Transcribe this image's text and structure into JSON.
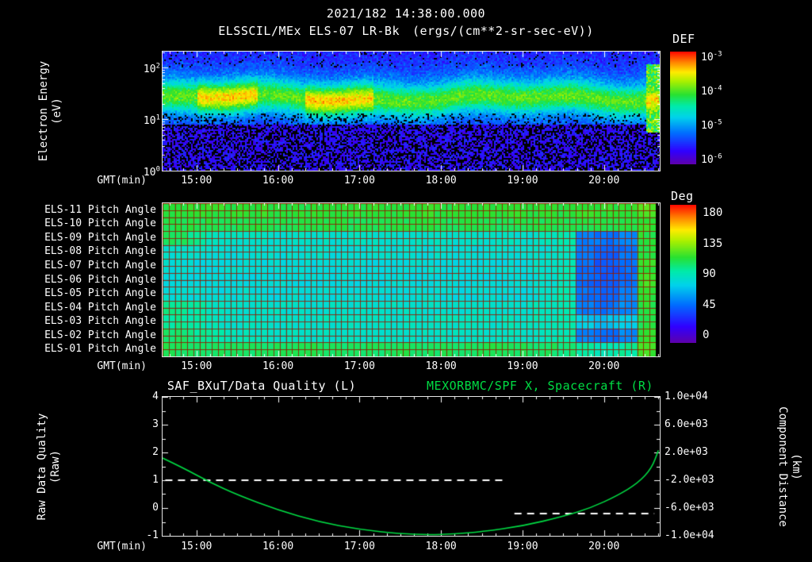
{
  "header": {
    "datetime": "2021/182 14:38:00.000"
  },
  "colors": {
    "background": "#000000",
    "foreground": "#ffffff",
    "spacecraft_green": "#00dd44"
  },
  "chart_data": [
    {
      "id": "energy_spectrogram",
      "type": "heatmap",
      "title": "ELSSCIL/MEx ELS-07 LR-Bk",
      "units": "(ergs/(cm**2-sr-sec-eV))",
      "xlabel": "GMT(min)",
      "ylabel_lines": [
        "Electron Energy",
        "(eV)"
      ],
      "x_ticks": [
        "15:00",
        "16:00",
        "17:00",
        "18:00",
        "19:00",
        "20:00"
      ],
      "x_range_gmt": [
        "14:35",
        "20:41"
      ],
      "y_ticks": [
        "10^2",
        "10^1",
        "10^0"
      ],
      "y_scale": "log10_eV",
      "y_range_log10": [
        0,
        2.31
      ],
      "colorbar": {
        "title": "DEF",
        "tick_labels": [
          "10^-3",
          "10^-4",
          "10^-5",
          "10^-6"
        ],
        "log10_range": [
          -3,
          -6
        ]
      },
      "features": {
        "background_log10_flux": -5.7,
        "band_center_log10_eV": 1.4,
        "band_halfwidth_log10": 0.25,
        "band_peak_log10_flux": -4.1,
        "yellow_intervals_gmt": [
          "15:00-15:45",
          "16:20-17:10",
          "20:30-20:40"
        ],
        "black_speckle_below_eV": 8
      }
    },
    {
      "id": "pitch_angle_map",
      "type": "heatmap",
      "xlabel": "GMT(min)",
      "x_ticks": [
        "15:00",
        "16:00",
        "17:00",
        "18:00",
        "19:00",
        "20:00"
      ],
      "x_range_gmt": [
        "14:35",
        "20:41"
      ],
      "row_labels": [
        "ELS-11 Pitch Angle",
        "ELS-10 Pitch Angle",
        "ELS-09 Pitch Angle",
        "ELS-08 Pitch Angle",
        "ELS-07 Pitch Angle",
        "ELS-06 Pitch Angle",
        "ELS-05 Pitch Angle",
        "ELS-04 Pitch Angle",
        "ELS-03 Pitch Angle",
        "ELS-02 Pitch Angle",
        "ELS-01 Pitch Angle"
      ],
      "colorbar": {
        "title": "Deg",
        "tick_labels": [
          "180",
          "135",
          "90",
          "45",
          "0"
        ],
        "range": [
          0,
          180
        ]
      },
      "time_bins": 24,
      "values_deg": [
        [
          112,
          111,
          112,
          110,
          112,
          111,
          110,
          112,
          111,
          110,
          112,
          111,
          112,
          110,
          111,
          112,
          110,
          112,
          111,
          110,
          112,
          111,
          112,
          118
        ],
        [
          108,
          107,
          108,
          106,
          108,
          107,
          106,
          108,
          107,
          106,
          108,
          107,
          108,
          106,
          107,
          108,
          106,
          108,
          107,
          106,
          108,
          107,
          110,
          114
        ],
        [
          104,
          98,
          88,
          86,
          86,
          85,
          86,
          86,
          84,
          86,
          85,
          84,
          86,
          86,
          84,
          85,
          86,
          84,
          88,
          92,
          56,
          52,
          56,
          110
        ],
        [
          84,
          84,
          82,
          82,
          83,
          82,
          82,
          84,
          82,
          82,
          83,
          82,
          82,
          84,
          82,
          82,
          83,
          82,
          84,
          88,
          52,
          48,
          52,
          110
        ],
        [
          82,
          80,
          80,
          81,
          80,
          80,
          82,
          80,
          80,
          81,
          80,
          80,
          82,
          80,
          80,
          81,
          80,
          80,
          84,
          88,
          50,
          46,
          50,
          112
        ],
        [
          80,
          80,
          81,
          80,
          80,
          81,
          80,
          80,
          81,
          80,
          80,
          81,
          80,
          80,
          81,
          80,
          80,
          81,
          84,
          88,
          50,
          46,
          50,
          114
        ],
        [
          82,
          81,
          80,
          82,
          81,
          80,
          82,
          81,
          80,
          82,
          81,
          80,
          82,
          81,
          80,
          82,
          81,
          80,
          84,
          90,
          52,
          48,
          54,
          112
        ],
        [
          98,
          93,
          86,
          84,
          84,
          85,
          84,
          84,
          85,
          84,
          84,
          85,
          84,
          84,
          85,
          84,
          84,
          85,
          88,
          92,
          56,
          52,
          58,
          110
        ],
        [
          96,
          92,
          88,
          86,
          87,
          86,
          86,
          87,
          86,
          86,
          87,
          86,
          86,
          87,
          86,
          86,
          87,
          86,
          88,
          92,
          74,
          72,
          76,
          108
        ],
        [
          102,
          97,
          93,
          88,
          86,
          86,
          86,
          86,
          85,
          86,
          86,
          85,
          86,
          86,
          85,
          86,
          86,
          85,
          88,
          92,
          56,
          52,
          58,
          110
        ],
        [
          106,
          105,
          104,
          106,
          104,
          105,
          104,
          106,
          104,
          105,
          104,
          106,
          104,
          105,
          104,
          106,
          104,
          105,
          104,
          100,
          94,
          92,
          96,
          115
        ]
      ]
    },
    {
      "id": "quality_distance_plot",
      "type": "line",
      "title_left": "SAF_BXuT/Data Quality (L)",
      "title_right": "MEXORBMC/SPF X, Spacecraft (R)",
      "title_right_color": "#00dd44",
      "xlabel": "GMT(min)",
      "x_ticks": [
        "15:00",
        "16:00",
        "17:00",
        "18:00",
        "19:00",
        "20:00"
      ],
      "x_range_gmt": [
        "14:35",
        "20:41"
      ],
      "left_axis": {
        "label_lines": [
          "Raw Data Quality",
          "(Raw)"
        ],
        "ticks": [
          "4",
          "3",
          "2",
          "1",
          "0",
          "-1"
        ],
        "range": [
          -1,
          4
        ]
      },
      "right_axis": {
        "label_lines": [
          "Component Distance",
          "(km)"
        ],
        "ticks": [
          "1.0e+04",
          "6.0e+03",
          "2.0e+03",
          "-2.0e+03",
          "-6.0e+03",
          "-1.0e+04"
        ],
        "range": [
          -10000,
          10000
        ]
      },
      "series": [
        {
          "name": "SAF_BXuT/Data Quality",
          "axis": "left",
          "color": "#ffffff",
          "style": "dashed",
          "segments": [
            {
              "x_gmt": [
                "14:37",
                "18:49"
              ],
              "y": [
                1,
                1
              ]
            },
            {
              "x_gmt": [
                "18:54",
                "20:37"
              ],
              "y": [
                -0.2,
                -0.2
              ]
            }
          ]
        },
        {
          "name": "MEXORBMC/SPF X Spacecraft",
          "axis": "right",
          "color": "#00dd44",
          "style": "solid",
          "points": [
            [
              "14:35",
              1200
            ],
            [
              "14:50",
              -200
            ],
            [
              "15:10",
              -2300
            ],
            [
              "15:30",
              -4100
            ],
            [
              "16:00",
              -6300
            ],
            [
              "16:30",
              -8000
            ],
            [
              "17:00",
              -9100
            ],
            [
              "17:30",
              -9700
            ],
            [
              "17:50",
              -9850
            ],
            [
              "18:10",
              -9750
            ],
            [
              "18:30",
              -9400
            ],
            [
              "19:00",
              -8600
            ],
            [
              "19:30",
              -7200
            ],
            [
              "19:50",
              -6000
            ],
            [
              "20:10",
              -4200
            ],
            [
              "20:25",
              -2400
            ],
            [
              "20:35",
              -300
            ],
            [
              "20:40",
              2300
            ]
          ]
        }
      ]
    }
  ]
}
